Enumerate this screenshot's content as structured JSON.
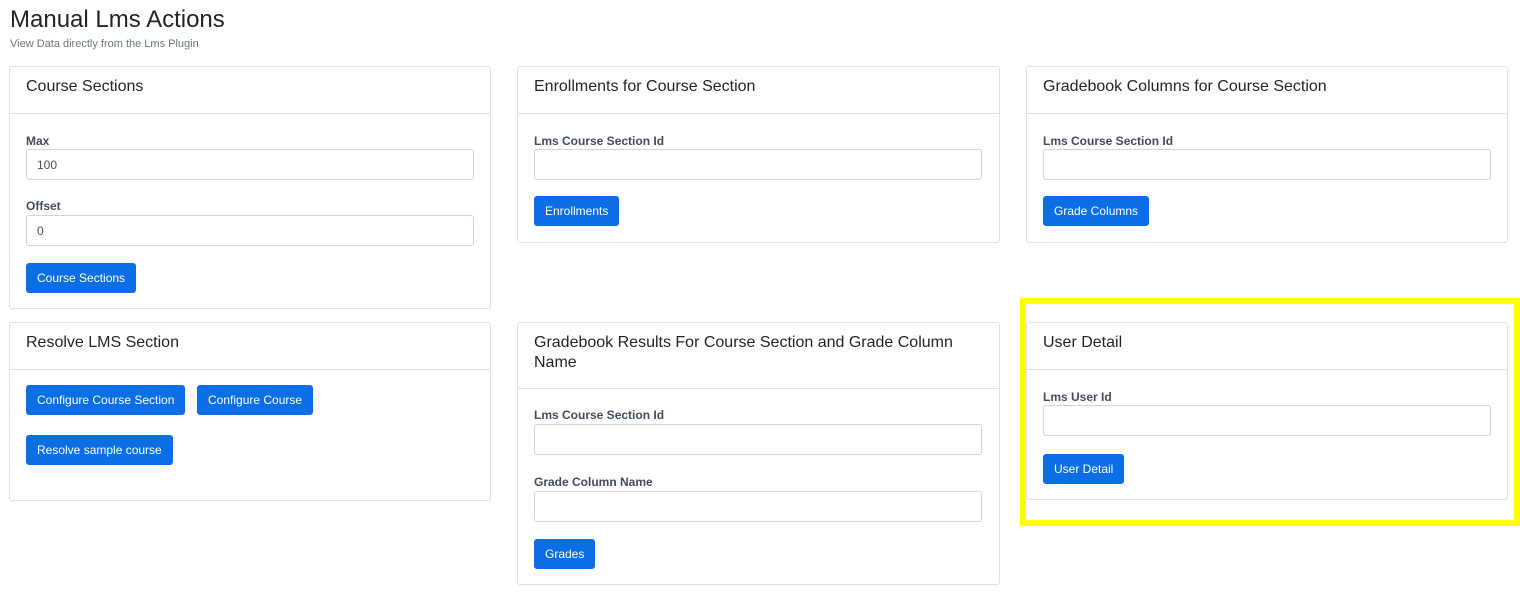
{
  "page": {
    "title": "Manual Lms Actions",
    "subtitle": "View Data directly from the Lms Plugin"
  },
  "course_sections": {
    "header": "Course Sections",
    "max_label": "Max",
    "max_value": "100",
    "offset_label": "Offset",
    "offset_value": "0",
    "button": "Course Sections"
  },
  "enrollments": {
    "header": "Enrollments for Course Section",
    "section_label": "Lms Course Section Id",
    "section_value": "",
    "button": "Enrollments"
  },
  "gradebook_columns": {
    "header": "Gradebook Columns for Course Section",
    "section_label": "Lms Course Section Id",
    "section_value": "",
    "button": "Grade Columns"
  },
  "resolve_section": {
    "header": "Resolve LMS Section",
    "configure_section_button": "Configure Course Section",
    "configure_course_button": "Configure Course",
    "resolve_sample_button": "Resolve sample course"
  },
  "gradebook_results": {
    "header": "Gradebook Results For Course Section and Grade Column Name",
    "section_label": "Lms Course Section Id",
    "section_value": "",
    "column_label": "Grade Column Name",
    "column_value": "",
    "button": "Grades"
  },
  "user_detail": {
    "header": "User Detail",
    "user_label": "Lms User Id",
    "user_value": "",
    "button": "User Detail"
  },
  "colors": {
    "primary": "#0a6fe6",
    "highlight": "#ffff00",
    "border": "#dfe1e4",
    "label": "#414c5e"
  }
}
